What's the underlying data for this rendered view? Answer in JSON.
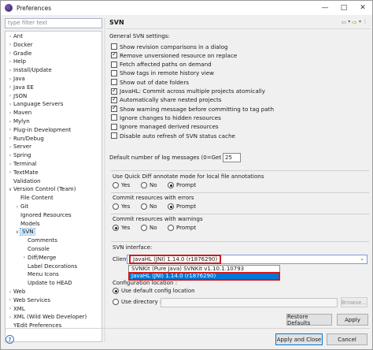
{
  "window": {
    "title": "Preferences",
    "controls": [
      "—",
      "□",
      "✕"
    ]
  },
  "filter_placeholder": "type filter text",
  "tree": [
    {
      "label": "Ant",
      "arrow": ">",
      "depth": 0
    },
    {
      "label": "Docker",
      "arrow": ">",
      "depth": 0
    },
    {
      "label": "Gradle",
      "arrow": ">",
      "depth": 0
    },
    {
      "label": "Help",
      "arrow": ">",
      "depth": 0
    },
    {
      "label": "Install/Update",
      "arrow": ">",
      "depth": 0
    },
    {
      "label": "Java",
      "arrow": ">",
      "depth": 0
    },
    {
      "label": "Java EE",
      "arrow": ">",
      "depth": 0
    },
    {
      "label": "JSON",
      "arrow": ">",
      "depth": 0
    },
    {
      "label": "Language Servers",
      "arrow": ">",
      "depth": 0
    },
    {
      "label": "Maven",
      "arrow": ">",
      "depth": 0
    },
    {
      "label": "Mylyn",
      "arrow": ">",
      "depth": 0
    },
    {
      "label": "Plug-in Development",
      "arrow": ">",
      "depth": 0
    },
    {
      "label": "Run/Debug",
      "arrow": ">",
      "depth": 0
    },
    {
      "label": "Server",
      "arrow": ">",
      "depth": 0
    },
    {
      "label": "Spring",
      "arrow": ">",
      "depth": 0
    },
    {
      "label": "Terminal",
      "arrow": ">",
      "depth": 0
    },
    {
      "label": "TextMate",
      "arrow": ">",
      "depth": 0
    },
    {
      "label": "Validation",
      "arrow": "",
      "depth": 0
    },
    {
      "label": "Version Control (Team)",
      "arrow": "v",
      "depth": 0
    },
    {
      "label": "File Content",
      "arrow": "",
      "depth": 1
    },
    {
      "label": "Git",
      "arrow": ">",
      "depth": 1
    },
    {
      "label": "Ignored Resources",
      "arrow": "",
      "depth": 1
    },
    {
      "label": "Models",
      "arrow": "",
      "depth": 1
    },
    {
      "label": "SVN",
      "arrow": "v",
      "depth": 1,
      "selected": true
    },
    {
      "label": "Comments",
      "arrow": "",
      "depth": 2
    },
    {
      "label": "Console",
      "arrow": "",
      "depth": 2
    },
    {
      "label": "Diff/Merge",
      "arrow": ">",
      "depth": 2
    },
    {
      "label": "Label Decorations",
      "arrow": "",
      "depth": 2
    },
    {
      "label": "Menu Icons",
      "arrow": "",
      "depth": 2
    },
    {
      "label": "Update to HEAD",
      "arrow": "",
      "depth": 2
    },
    {
      "label": "Web",
      "arrow": ">",
      "depth": 0
    },
    {
      "label": "Web Services",
      "arrow": ">",
      "depth": 0
    },
    {
      "label": "XML",
      "arrow": ">",
      "depth": 0
    },
    {
      "label": "XML (Wild Web Developer)",
      "arrow": ">",
      "depth": 0
    },
    {
      "label": "YEdit Preferences",
      "arrow": "",
      "depth": 0
    }
  ],
  "page": {
    "title": "SVN",
    "section": "General SVN settings:",
    "checkboxes": [
      {
        "label": "Show revision comparisons in a dialog",
        "checked": false
      },
      {
        "label": "Remove unversioned resource on replace",
        "checked": true
      },
      {
        "label": "Fetch affected paths on demand",
        "checked": false
      },
      {
        "label": "Show tags in remote history view",
        "checked": false
      },
      {
        "label": "Show out of date folders",
        "checked": false
      },
      {
        "label": "JavaHL: Commit across multiple projects atomically",
        "checked": true
      },
      {
        "label": "Automatically share nested projects",
        "checked": true
      },
      {
        "label": "Show warning message before committing to tag path",
        "checked": true
      },
      {
        "label": "Ignore changes to hidden resources",
        "checked": false
      },
      {
        "label": "Ignore managed derived resources",
        "checked": false
      },
      {
        "label": "Disable auto refresh of SVN status cache",
        "checked": false
      }
    ],
    "log_messages_label": "Default number of log messages (0=Get All)",
    "log_messages_value": "25",
    "quickdiff_label": "Use Quick Diff annotate mode for local file annotations",
    "errors_label": "Commit resources with errors",
    "warnings_label": "Commit resources with warnings",
    "opt_yes": "Yes",
    "opt_no": "No",
    "opt_prompt": "Prompt",
    "quickdiff_selected": "Prompt",
    "errors_selected": "Prompt",
    "warnings_selected": "Yes",
    "svn_interface_label": "SVN interface:",
    "client_label": "Client:",
    "client_value": "JavaHL (JNI) 1.14.0 (r1876290)",
    "client_options": [
      "SVNKit (Pure Java) SVNKit v1.10.1.10793",
      "JavaHL (JNI) 1.14.0 (r1876290)"
    ],
    "config_location_label": "Configuration location :",
    "use_default_label": "Use default config location",
    "use_directory_label": "Use directory :",
    "browse_label": "Browse...",
    "restore_defaults": "Restore Defaults",
    "apply": "Apply",
    "apply_close": "Apply and Close",
    "cancel": "Cancel",
    "help": "?"
  },
  "colors": {
    "accent": "#0078d7",
    "highlight_border": "#d11b1b",
    "selection": "#cde8ff"
  }
}
